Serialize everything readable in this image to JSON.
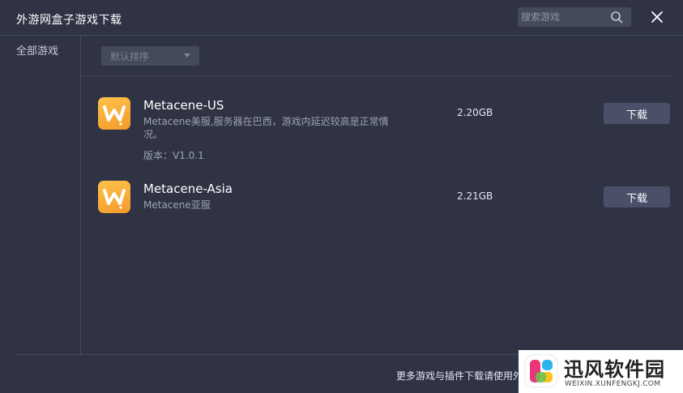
{
  "window": {
    "title": "外游网盒子游戏下载"
  },
  "search": {
    "placeholder": "搜索游戏"
  },
  "sidebar": {
    "items": [
      {
        "label": "全部游戏"
      }
    ]
  },
  "sort": {
    "selected": "默认排序"
  },
  "games": [
    {
      "name": "Metacene-US",
      "description": "Metacene美服,服务器在巴西，游戏内延迟较高是正常情况。",
      "version": "版本：V1.0.1",
      "size": "2.20GB",
      "download_label": "下载",
      "icon": "metacene-logo-icon"
    },
    {
      "name": "Metacene-Asia",
      "description": "Metacene亚服",
      "size": "2.21GB",
      "download_label": "下载",
      "icon": "metacene-logo-icon"
    }
  ],
  "footer": {
    "text": "更多游戏与插件下载请使用外"
  },
  "watermark": {
    "title": "迅风软件园",
    "subtitle": "WEIXIN.XUNFENGKJ.COM"
  },
  "colors": {
    "background": "#2f3344",
    "divider": "#464b5c",
    "button": "#4a5068",
    "input": "#454a5a",
    "icon_orange": "#f5a431"
  },
  "icons": {
    "search": "search-icon",
    "close": "close-icon",
    "dropdown": "caret-down-icon"
  }
}
